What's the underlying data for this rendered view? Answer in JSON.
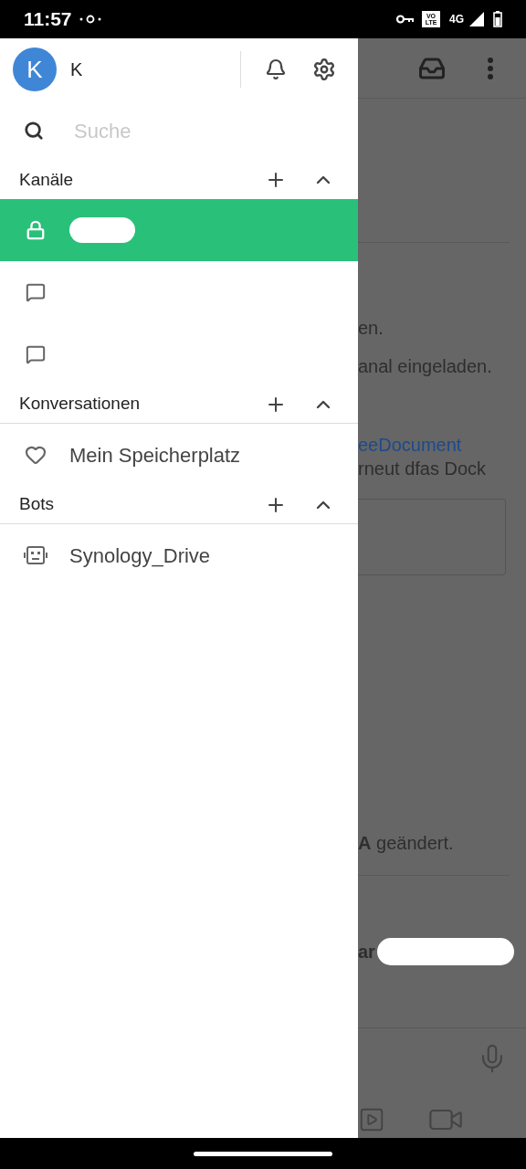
{
  "status_bar": {
    "time": "11:57",
    "volte_top": "VO",
    "volte_bottom": "LTE",
    "network": "4G"
  },
  "drawer": {
    "user": {
      "initial": "K",
      "name": "K"
    },
    "search": {
      "placeholder": "Suche"
    },
    "sections": [
      {
        "title": "Kanäle",
        "expanded": true,
        "items": [
          {
            "kind": "private",
            "selected": true,
            "redacted": true
          },
          {
            "kind": "public",
            "selected": false,
            "redacted": false
          },
          {
            "kind": "public",
            "selected": false,
            "redacted": false
          }
        ]
      },
      {
        "title": "Konversationen",
        "expanded": true,
        "items": [
          {
            "kind": "favorite",
            "selected": false,
            "name": "Mein Speicherplatz"
          }
        ]
      },
      {
        "title": "Bots",
        "expanded": true,
        "items": [
          {
            "kind": "bot",
            "selected": false,
            "name": "Synology_Drive"
          }
        ]
      }
    ]
  },
  "background_chat": {
    "messages": [
      {
        "kind": "plain",
        "text": "en."
      },
      {
        "kind": "plain",
        "text": "anal eingeladen."
      },
      {
        "kind": "link",
        "text": "eeDocument"
      },
      {
        "kind": "plain",
        "text": "rneut dfas Dock"
      },
      {
        "kind": "rich",
        "text": "**A** geändert."
      },
      {
        "kind": "bold",
        "text": "ar"
      }
    ]
  }
}
